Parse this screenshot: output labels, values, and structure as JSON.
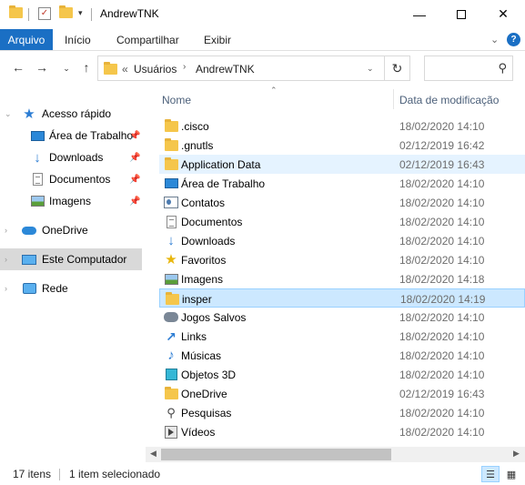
{
  "window": {
    "title": "AndrewTNK",
    "minimize_icon": "minimize-icon",
    "maximize_icon": "maximize-icon",
    "close_icon": "close-icon"
  },
  "ribbon": {
    "file_tab": "Arquivo",
    "tabs": [
      "Início",
      "Compartilhar",
      "Exibir"
    ]
  },
  "address": {
    "overflow": "«",
    "parts": [
      "Usuários",
      "AndrewTNK"
    ],
    "search_placeholder": ""
  },
  "nav": {
    "quick_access": "Acesso rápido",
    "quick_items": [
      {
        "label": "Área de Trabalho",
        "icon": "desktop-icon",
        "pinned": true
      },
      {
        "label": "Downloads",
        "icon": "downloads-icon",
        "pinned": true
      },
      {
        "label": "Documentos",
        "icon": "documents-icon",
        "pinned": true
      },
      {
        "label": "Imagens",
        "icon": "pictures-icon",
        "pinned": true
      }
    ],
    "onedrive": "OneDrive",
    "this_pc": "Este Computador",
    "network": "Rede"
  },
  "columns": {
    "name": "Nome",
    "date": "Data de modificação"
  },
  "files": [
    {
      "name": ".cisco",
      "date": "18/02/2020 14:10",
      "icon": "folder-icon"
    },
    {
      "name": ".gnutls",
      "date": "02/12/2019 16:42",
      "icon": "folder-icon"
    },
    {
      "name": "Application Data",
      "date": "02/12/2019 16:43",
      "icon": "folder-icon"
    },
    {
      "name": "Área de Trabalho",
      "date": "18/02/2020 14:10",
      "icon": "desktop-icon"
    },
    {
      "name": "Contatos",
      "date": "18/02/2020 14:10",
      "icon": "contacts-icon"
    },
    {
      "name": "Documentos",
      "date": "18/02/2020 14:10",
      "icon": "documents-icon"
    },
    {
      "name": "Downloads",
      "date": "18/02/2020 14:10",
      "icon": "downloads-icon"
    },
    {
      "name": "Favoritos",
      "date": "18/02/2020 14:10",
      "icon": "favorites-icon"
    },
    {
      "name": "Imagens",
      "date": "18/02/2020 14:18",
      "icon": "pictures-icon"
    },
    {
      "name": "insper",
      "date": "18/02/2020 14:19",
      "icon": "folder-icon"
    },
    {
      "name": "Jogos Salvos",
      "date": "18/02/2020 14:10",
      "icon": "saved-games-icon"
    },
    {
      "name": "Links",
      "date": "18/02/2020 14:10",
      "icon": "links-icon"
    },
    {
      "name": "Músicas",
      "date": "18/02/2020 14:10",
      "icon": "music-icon"
    },
    {
      "name": "Objetos 3D",
      "date": "18/02/2020 14:10",
      "icon": "3d-objects-icon"
    },
    {
      "name": "OneDrive",
      "date": "02/12/2019 16:43",
      "icon": "folder-icon"
    },
    {
      "name": "Pesquisas",
      "date": "18/02/2020 14:10",
      "icon": "searches-icon"
    },
    {
      "name": "Vídeos",
      "date": "18/02/2020 14:10",
      "icon": "videos-icon"
    }
  ],
  "status": {
    "count": "17 itens",
    "selected": "1 item selecionado"
  },
  "colors": {
    "accent": "#1a6fc4",
    "selection": "#cce8ff",
    "hover": "#e5f3ff",
    "folder": "#f5c64b"
  }
}
